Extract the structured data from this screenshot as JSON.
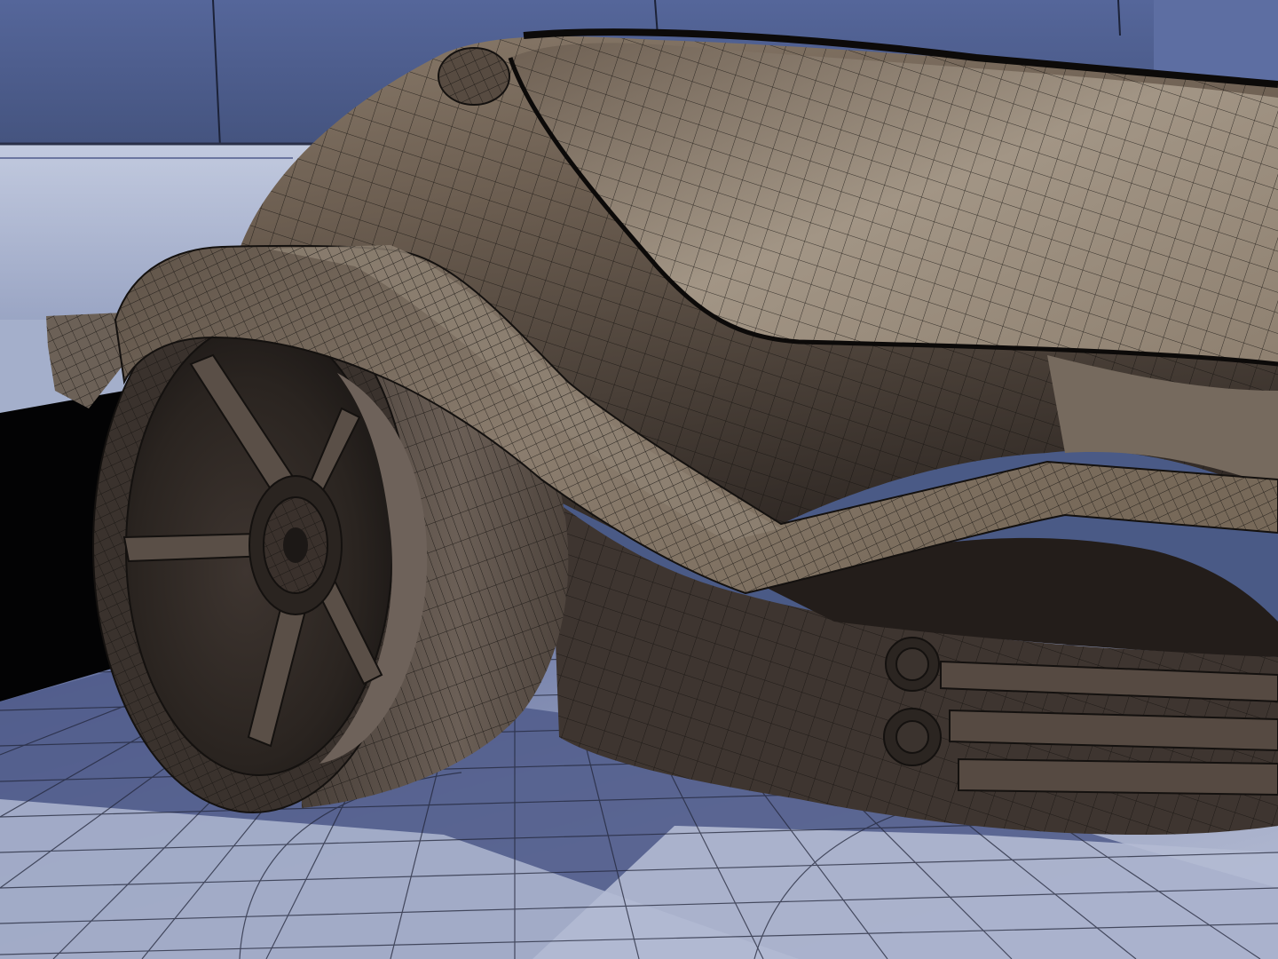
{
  "scene": {
    "subject": "wireframe-render-concept-vehicle-front-wheel",
    "colors": {
      "backdrop_wall": "#4b5b88",
      "backdrop_wall_light": "#6474a3",
      "white_panel": "#b4bed6",
      "white_panel_shadow": "#8d98b8",
      "floor_lit": "#a8b0ca",
      "floor_shadow": "#4d5986",
      "floor_shadow_dark": "#3e4870",
      "floor_wire": "#2b2f3d",
      "body_dark": "#2e2723",
      "body_mid": "#5a4d43",
      "body_light": "#8a7b6d",
      "body_highlight": "#a09383",
      "wire": "#14110f",
      "black_gap": "#030304"
    }
  }
}
